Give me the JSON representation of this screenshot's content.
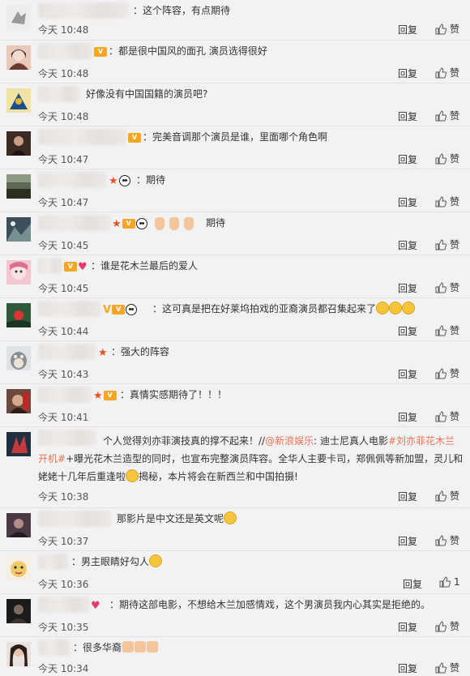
{
  "colors": {
    "background": "#f2f2f5",
    "link": "#eb7350",
    "divider": "#e2e2e2"
  },
  "comments": [
    {
      "text": "：这个阵容，有点期待",
      "time": "今天 10:48",
      "reply": "回复",
      "like": "赞"
    },
    {
      "text": "：都是很中国风的面孔 演员选得很好",
      "time": "今天 10:48",
      "reply": "回复",
      "like": "赞"
    },
    {
      "text": "好像没有中国国籍的演员吧?",
      "time": "今天 10:48",
      "reply": "回复",
      "like": "赞"
    },
    {
      "text": "：完美音调那个演员是谁，里面哪个角色啊",
      "time": "今天 10:47",
      "reply": "回复",
      "like": "赞"
    },
    {
      "text": "：期待",
      "time": "今天 10:47",
      "reply": "回复",
      "like": "赞"
    },
    {
      "text": "期待",
      "time": "今天 10:45",
      "reply": "回复",
      "like": "赞"
    },
    {
      "text": "：谁是花木兰最后的爱人",
      "time": "今天 10:45",
      "reply": "回复",
      "like": "赞"
    },
    {
      "text": "：这可真是把在好莱坞拍戏的亚裔演员都召集起来了",
      "time": "今天 10:44",
      "reply": "回复",
      "like": "赞"
    },
    {
      "text": "：强大的阵容",
      "time": "今天 10:43",
      "reply": "回复",
      "like": "赞"
    },
    {
      "text": "：真情实感期待了！！！",
      "time": "今天 10:41",
      "reply": "回复",
      "like": "赞"
    },
    {
      "text_a": "个人觉得刘亦菲演技真的撑不起来！//",
      "link_a": "@新浪娱乐",
      "text_b": ": 迪士尼真人电影",
      "link_b": "#刘亦菲花木兰开机#",
      "text_c": "+曝光花木兰造型的同时，也宣布完整演员阵容。全华人主要卡司，郑佩佩等新加盟，灵儿和姥姥十几年后重逢啦",
      "text_d": "揭秘，本片将会在新西兰和中国拍摄!",
      "time": "今天 10:38",
      "reply": "回复",
      "like": "赞"
    },
    {
      "text": "那影片是中文还是英文呢",
      "time": "今天 10:37",
      "reply": "回复",
      "like": "赞"
    },
    {
      "text": "：男主眼睛好勾人",
      "time": "今天 10:36",
      "reply": "回复",
      "like": "1"
    },
    {
      "text": "：期待这部电影，不想给木兰加感情戏，这个男演员我内心其实是拒绝的。",
      "time": "今天 10:35",
      "reply": "回复",
      "like": "赞"
    },
    {
      "text": "：很多华裔",
      "time": "今天 10:34",
      "reply": "回复",
      "like": "赞"
    }
  ]
}
